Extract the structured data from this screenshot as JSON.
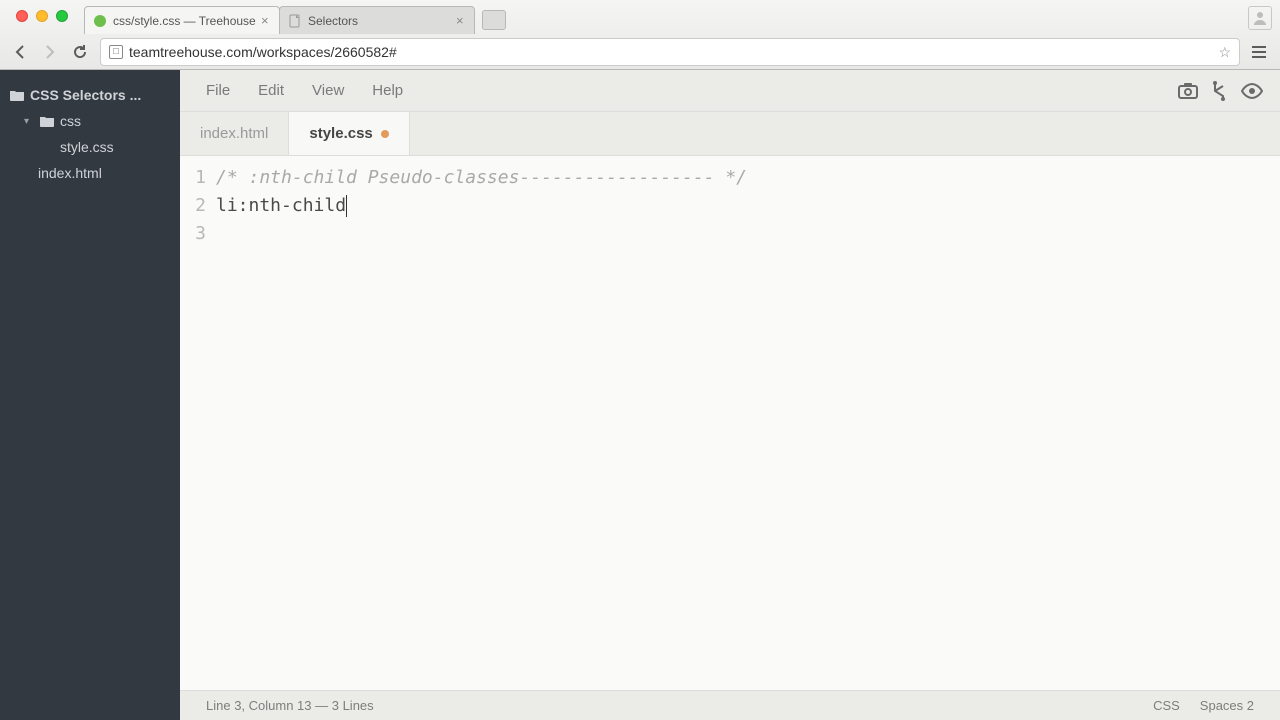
{
  "browser": {
    "tabs": [
      {
        "title": "css/style.css — Treehouse",
        "active": true
      },
      {
        "title": "Selectors",
        "active": false
      }
    ],
    "url": "teamtreehouse.com/workspaces/2660582#"
  },
  "sidebar": {
    "project": "CSS Selectors ...",
    "items": [
      {
        "name": "css",
        "type": "folder",
        "children": [
          {
            "name": "style.css",
            "type": "file"
          }
        ]
      },
      {
        "name": "index.html",
        "type": "file"
      }
    ]
  },
  "menubar": {
    "items": [
      "File",
      "Edit",
      "View",
      "Help"
    ]
  },
  "editor_tabs": [
    {
      "label": "index.html",
      "active": false,
      "modified": false
    },
    {
      "label": "style.css",
      "active": true,
      "modified": true
    }
  ],
  "editor": {
    "lines": [
      {
        "n": 1,
        "text": "/* :nth-child Pseudo-classes------------------ */",
        "cls": "comment"
      },
      {
        "n": 2,
        "text": "",
        "cls": ""
      },
      {
        "n": 3,
        "text": "li:nth-child",
        "cls": ""
      }
    ]
  },
  "status": {
    "left": "Line 3, Column 13 — 3 Lines",
    "lang": "CSS",
    "indent": "Spaces  2"
  }
}
